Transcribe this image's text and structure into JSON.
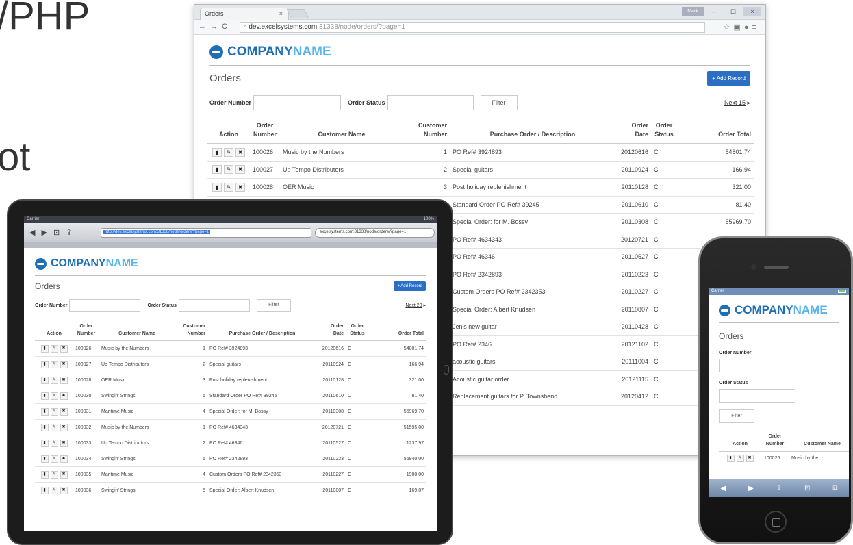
{
  "background": {
    "text1": "/PHP",
    "text2": "ot"
  },
  "desktop": {
    "tab_title": "Orders",
    "tab_close": "×",
    "user_button": "Mark",
    "window_min": "–",
    "window_max": "☐",
    "window_close": "×",
    "url_host": "dev.excelsystems.com",
    "url_path": ":31338/node/orders/?page=1",
    "logo_a": "COMPANY",
    "logo_b": "NAME",
    "page_title": "Orders",
    "add_label": "+ Add Record",
    "order_number_label": "Order Number",
    "order_status_label": "Order Status",
    "filter_label": "Filter",
    "next_label": "Next 15",
    "headers": [
      "Action",
      "Order Number",
      "Customer Name",
      "Customer Number",
      "Purchase Order / Description",
      "Order Date",
      "Order Status",
      "Order Total"
    ],
    "rows": [
      {
        "num": "100026",
        "name": "Music by the Numbers",
        "cust": "1",
        "desc": "PO Ref# 3924893",
        "date": "20120616",
        "status": "C",
        "total": "54801.74"
      },
      {
        "num": "100027",
        "name": "Up Tempo Distributors",
        "cust": "2",
        "desc": "Special guitars",
        "date": "20110924",
        "status": "C",
        "total": "166.94"
      },
      {
        "num": "100028",
        "name": "OER Music",
        "cust": "3",
        "desc": "Post holiday replenishment",
        "date": "20110128",
        "status": "C",
        "total": "321.00"
      },
      {
        "num": "",
        "name": "",
        "cust": "",
        "desc": "Standard Order PO Ref# 39245",
        "date": "20110610",
        "status": "C",
        "total": "81.40"
      },
      {
        "num": "",
        "name": "",
        "cust": "",
        "desc": "Special Order: for M. Bossy",
        "date": "20110308",
        "status": "C",
        "total": "55969.70"
      },
      {
        "num": "",
        "name": "",
        "cust": "",
        "desc": "PO Ref# 4634343",
        "date": "20120721",
        "status": "C",
        "total": "51595.00"
      },
      {
        "num": "",
        "name": "",
        "cust": "",
        "desc": "PO Ref# 46346",
        "date": "20110527",
        "status": "C",
        "total": ""
      },
      {
        "num": "",
        "name": "",
        "cust": "",
        "desc": "PO Ref# 2342893",
        "date": "20110223",
        "status": "C",
        "total": ""
      },
      {
        "num": "",
        "name": "",
        "cust": "",
        "desc": "Custom Orders PO Ref# 2342353",
        "date": "20110227",
        "status": "C",
        "total": ""
      },
      {
        "num": "",
        "name": "",
        "cust": "",
        "desc": "Special Order: Albert Knudsen",
        "date": "20110807",
        "status": "C",
        "total": ""
      },
      {
        "num": "",
        "name": "",
        "cust": "",
        "desc": "Jen's new guitar",
        "date": "20110428",
        "status": "C",
        "total": ""
      },
      {
        "num": "",
        "name": "",
        "cust": "",
        "desc": "PO Ref# 2346",
        "date": "20121102",
        "status": "C",
        "total": ""
      },
      {
        "num": "",
        "name": "",
        "cust": "",
        "desc": "acoustic guitars",
        "date": "20111004",
        "status": "C",
        "total": ""
      },
      {
        "num": "",
        "name": "",
        "cust": "",
        "desc": "Acoustic guitar order",
        "date": "20121115",
        "status": "C",
        "total": ""
      },
      {
        "num": "",
        "name": "",
        "cust": "",
        "desc": "Replacement guitars for P. Townshend",
        "date": "20120412",
        "status": "C",
        "total": ""
      }
    ]
  },
  "tablet": {
    "carrier": "Carrier",
    "battery": "100%",
    "url": "http://dev.excelsystems.com:31338/node/orders/?page=1",
    "search": "excelsystems.com:31338/node/orders/?page=1",
    "logo_a": "COMPANY",
    "logo_b": "NAME",
    "page_title": "Orders",
    "add_label": "+ Add Record",
    "order_number_label": "Order Number",
    "order_status_label": "Order Status",
    "filter_label": "Filter",
    "next_label": "Next 20",
    "headers": [
      "Action",
      "Order Number",
      "Customer Name",
      "Customer Number",
      "Purchase Order / Description",
      "Order Date",
      "Order Status",
      "Order Total"
    ],
    "rows": [
      {
        "num": "100026",
        "name": "Music by the Numbers",
        "cust": "1",
        "desc": "PO Ref# 3924893",
        "date": "20120616",
        "status": "C",
        "total": "54801.74"
      },
      {
        "num": "100027",
        "name": "Up Tempo Distributors",
        "cust": "2",
        "desc": "Special guitars",
        "date": "20110924",
        "status": "C",
        "total": "166.94"
      },
      {
        "num": "100028",
        "name": "OER Music",
        "cust": "3",
        "desc": "Post holiday replenishment",
        "date": "20110128",
        "status": "C",
        "total": "321.00"
      },
      {
        "num": "100030",
        "name": "Swingin' Strings",
        "cust": "5",
        "desc": "Standard Order PO Ref# 39245",
        "date": "20110610",
        "status": "C",
        "total": "81.40"
      },
      {
        "num": "100031",
        "name": "Maritime Music",
        "cust": "4",
        "desc": "Special Order: for M. Bossy",
        "date": "20110308",
        "status": "C",
        "total": "55969.70"
      },
      {
        "num": "100032",
        "name": "Music by the Numbers",
        "cust": "1",
        "desc": "PO Ref# 4634343",
        "date": "20120721",
        "status": "C",
        "total": "51595.00"
      },
      {
        "num": "100033",
        "name": "Up Tempo Distributors",
        "cust": "2",
        "desc": "PO Ref# 46346",
        "date": "20110527",
        "status": "C",
        "total": "1237.97"
      },
      {
        "num": "100034",
        "name": "Swingin' Strings",
        "cust": "5",
        "desc": "PO Ref# 2342893",
        "date": "20110223",
        "status": "C",
        "total": "55940.00"
      },
      {
        "num": "100035",
        "name": "Maritime Music",
        "cust": "4",
        "desc": "Custom Orders PO Ref# 2342353",
        "date": "20110227",
        "status": "C",
        "total": "1900.00"
      },
      {
        "num": "100036",
        "name": "Swingin' Strings",
        "cust": "5",
        "desc": "Special Order: Albert Knudsen",
        "date": "20110807",
        "status": "C",
        "total": "169.07"
      }
    ]
  },
  "phone": {
    "carrier": "Carrier",
    "logo_a": "COMPANY",
    "logo_b": "NAME",
    "page_title": "Orders",
    "order_number_label": "Order Number",
    "order_status_label": "Order Status",
    "filter_label": "Filter",
    "headers": [
      "Action",
      "Order Number",
      "Customer Name"
    ],
    "row": {
      "num": "100026",
      "name": "Music by the"
    }
  },
  "icons": {
    "view": "▮",
    "edit": "✎",
    "delete": "✖"
  },
  "colors": {
    "brand": "#1f6fb5",
    "brand_light": "#58b4ea",
    "button": "#2a6fc4"
  }
}
